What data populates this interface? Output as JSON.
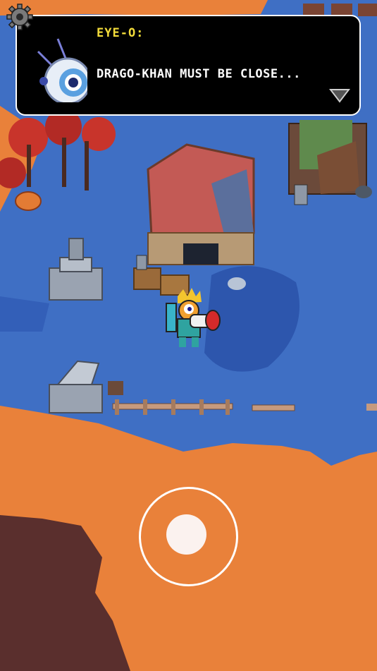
{
  "dialog": {
    "speaker": "EYE-O:",
    "message": "DRAGO-KHAN MUST BE CLOSE..."
  },
  "icons": {
    "settings": "gear-icon",
    "advance": "triangle-down-icon",
    "portrait": "eye-o-robot-portrait",
    "joystick": "virtual-joystick"
  },
  "colors": {
    "ground_orange": "#e9813a",
    "water_blue": "#3f6fc4",
    "dark_water": "#2b50a3",
    "pit_dark": "#5a2f2d",
    "dialog_bg": "#000000",
    "speaker_text": "#f3dc3a",
    "message_text": "#ffffff"
  }
}
